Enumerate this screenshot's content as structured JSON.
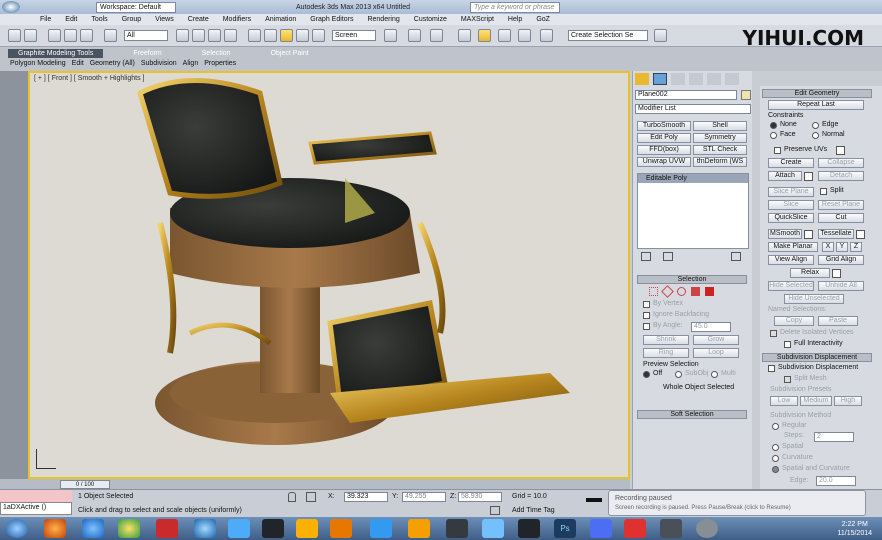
{
  "titlebar": {
    "workspace": "Workspace: Default",
    "app_title": "Autodesk 3ds Max 2013 x64     Untitled",
    "search_placeholder": "Type a keyword or phrase"
  },
  "menu": [
    "File",
    "Edit",
    "Tools",
    "Group",
    "Views",
    "Create",
    "Modifiers",
    "Animation",
    "Graph Editors",
    "Rendering",
    "Customize",
    "MAXScript",
    "Help",
    "GoZ"
  ],
  "brand": "YIHUI.COM",
  "toolbar": {
    "filter": "All",
    "ref_coord": "Screen",
    "selection_set": "Create Selection Se"
  },
  "ribbon": {
    "tabs": [
      "Graphite Modeling Tools",
      "Freeform",
      "Selection",
      "Object Paint"
    ],
    "subtabs": [
      "Polygon Modeling",
      "Edit",
      "Geometry (All)",
      "Subdivision",
      "Align",
      "Properties"
    ]
  },
  "viewport": {
    "label": "[ + ] [ Front ] [ Smooth + Highlights ]"
  },
  "timeline": {
    "frame": "0 / 100"
  },
  "command_panel": {
    "object_name": "Plane002",
    "modifier_list": "Modifier List",
    "mod_buttons": [
      "TurboSmooth",
      "Shell",
      "Edit Poly",
      "Symmetry",
      "FFD(box)",
      "STL Check",
      "Unwrap UVW",
      "tfnDeform (WS"
    ],
    "stack_item": "Editable Poly",
    "selection_title": "Selection",
    "by_vertex": "By Vertex",
    "ignore_backfacing": "Ignore Backfacing",
    "by_angle": "By Angle:",
    "by_angle_value": "45.0",
    "shrink": "Shrink",
    "grow": "Grow",
    "ring": "Ring",
    "loop": "Loop",
    "preview_selection": "Preview Selection",
    "preview_options": [
      "Off",
      "SubObj",
      "Multi"
    ],
    "whole_object": "Whole Object Selected",
    "soft_selection": "Soft Selection"
  },
  "edit_geometry": {
    "title": "Edit Geometry",
    "repeat_last": "Repeat Last",
    "constraints": "Constraints",
    "constraint_options": [
      "None",
      "Edge",
      "Face",
      "Normal"
    ],
    "preserve_uvs": "Preserve UVs",
    "create": "Create",
    "collapse": "Collapse",
    "attach": "Attach",
    "detach": "Detach",
    "slice_plane": "Slice Plane",
    "split": "Split",
    "slice": "Slice",
    "reset_plane": "Reset Plane",
    "quickslice": "QuickSlice",
    "cut": "Cut",
    "msmooth": "MSmooth",
    "tessellate": "Tessellate",
    "make_planar": "Make Planar",
    "xyz": [
      "X",
      "Y",
      "Z"
    ],
    "view_align": "View Align",
    "grid_align": "Grid Align",
    "relax": "Relax",
    "hide_selected": "Hide Selected",
    "unhide_all": "Unhide All",
    "hide_unselected": "Hide Unselected",
    "named_selections": "Named Selections:",
    "copy": "Copy",
    "paste": "Paste",
    "delete_isolated": "Delete Isolated Vertices",
    "full_interactivity": "Full Interactivity"
  },
  "subdivision": {
    "title": "Subdivision Displacement",
    "subdiv_disp": "Subdivision Displacement",
    "split_mesh": "Split Mesh",
    "presets": "Subdivision Presets",
    "low": "Low",
    "medium": "Medium",
    "high": "High",
    "method": "Subdivision Method",
    "method_options": [
      "Regular",
      "Spatial",
      "Curvature",
      "Spatial and Curvature"
    ],
    "steps_label": "Steps:",
    "steps_value": "2",
    "edge_label": "Edge:",
    "edge_value": "20.0"
  },
  "status": {
    "maxscript": "1aDXActive ()",
    "selected": "1 Object Selected",
    "prompt": "Click and drag to select and scale objects (uniformly)",
    "x_label": "X:",
    "x": "39.323",
    "y_label": "Y:",
    "y": "49.255",
    "z_label": "Z:",
    "z": "58.930",
    "grid": "Grid = 10.0",
    "add_time_tag": "Add Time Tag"
  },
  "balloon": {
    "line1": "Recording paused",
    "line2": "Screen recording is paused. Press Pause/Break (click to Resume)"
  },
  "clock": {
    "time": "2:22 PM",
    "date": "11/15/2014"
  }
}
